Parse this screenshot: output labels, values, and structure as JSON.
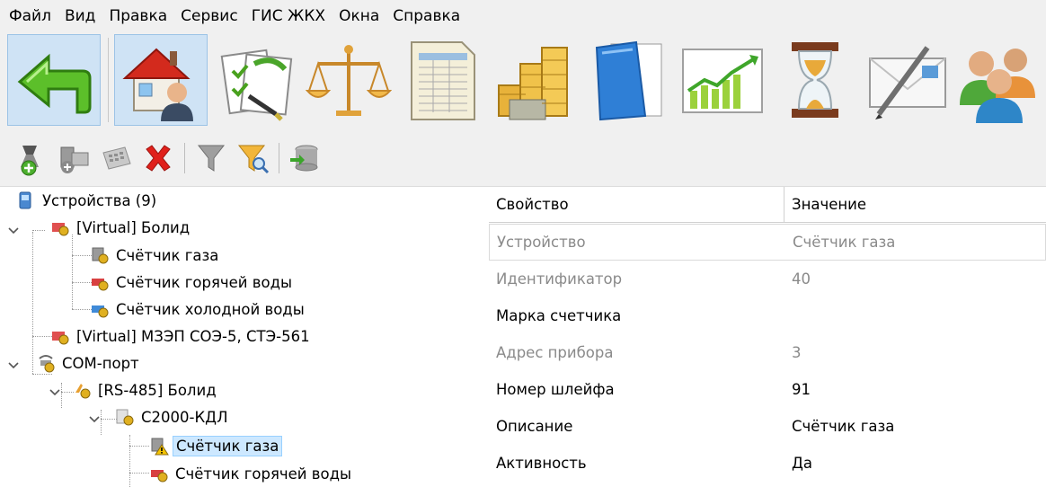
{
  "menu": [
    "Файл",
    "Вид",
    "Правка",
    "Сервис",
    "ГИС ЖКХ",
    "Окна",
    "Справка"
  ],
  "big_toolbar": [
    {
      "icon": "back-arrow-icon"
    },
    {
      "icon": "house-user-icon",
      "active": true
    },
    {
      "icon": "edit-documents-icon"
    },
    {
      "icon": "scales-icon"
    },
    {
      "icon": "spreadsheet-icon"
    },
    {
      "icon": "coins-icon"
    },
    {
      "icon": "blue-folder-icon"
    },
    {
      "icon": "growth-chart-icon"
    },
    {
      "icon": "hourglass-icon"
    },
    {
      "icon": "mail-pen-icon"
    },
    {
      "icon": "users-icon"
    }
  ],
  "small_toolbar": [
    {
      "icon": "add-device-icon"
    },
    {
      "icon": "add-computer-icon"
    },
    {
      "icon": "calculator-icon"
    },
    {
      "icon": "delete-icon"
    },
    {
      "icon": "filter-icon"
    },
    {
      "icon": "filter-search-icon"
    },
    {
      "icon": "database-export-icon"
    }
  ],
  "tree": {
    "root": "Устройства (9)",
    "nodes": [
      "[Virtual] Болид",
      "Счётчик газа",
      "Счётчик горячей воды",
      "Счётчик холодной воды",
      "[Virtual] МЗЭП СОЭ-5, СТЭ-561",
      "COM-порт",
      "[RS-485] Болид",
      "С2000-КДЛ",
      "Счётчик газа",
      "Счётчик горячей воды"
    ]
  },
  "grid": {
    "col_property": "Свойство",
    "col_value": "Значение",
    "rows": [
      {
        "property": "Устройство",
        "value": "Счётчик газа",
        "readonly": true
      },
      {
        "property": "Идентификатор",
        "value": "40",
        "readonly": true
      },
      {
        "property": "Марка счетчика",
        "value": "",
        "readonly": false
      },
      {
        "property": "Адрес прибора",
        "value": "3",
        "readonly": true
      },
      {
        "property": "Номер шлейфа",
        "value": "91",
        "readonly": false
      },
      {
        "property": "Описание",
        "value": "Счётчик газа",
        "readonly": false
      },
      {
        "property": "Активность",
        "value": "Да",
        "readonly": false
      }
    ]
  },
  "colors": {
    "toolbar_bg": "#f0f0f0",
    "active_button_bg": "#cfe3f5",
    "selection_bg": "#cde8ff",
    "readonly_text": "#8a8a8a",
    "delete_red": "#e0201b"
  }
}
